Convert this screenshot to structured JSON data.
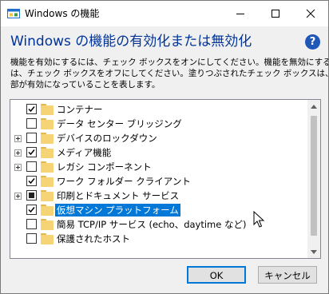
{
  "window": {
    "title": "Windows の機能"
  },
  "heading": "Windows の機能の有効化または無効化",
  "description": {
    "line1": "機能を有効にするには、チェック ボックスをオンにしてください。機能を無効にするに",
    "line2": "は、チェック ボックスをオフにしてください。塗りつぶされたチェック ボックスは、機能の一",
    "line3": "部が有効になっていることを表します。"
  },
  "features": [
    {
      "label": "コンテナー",
      "state": "checked",
      "expandable": false,
      "selected": false
    },
    {
      "label": "データ センター ブリッジング",
      "state": "unchecked",
      "expandable": false,
      "selected": false
    },
    {
      "label": "デバイスのロックダウン",
      "state": "unchecked",
      "expandable": true,
      "selected": false
    },
    {
      "label": "メディア機能",
      "state": "checked",
      "expandable": true,
      "selected": false
    },
    {
      "label": "レガシ コンポーネント",
      "state": "unchecked",
      "expandable": true,
      "selected": false
    },
    {
      "label": "ワーク フォルダー クライアント",
      "state": "checked",
      "expandable": false,
      "selected": false
    },
    {
      "label": "印刷とドキュメント サービス",
      "state": "partial",
      "expandable": true,
      "selected": false
    },
    {
      "label": "仮想マシン プラットフォーム",
      "state": "checked",
      "expandable": false,
      "selected": true
    },
    {
      "label": "簡易 TCP/IP サービス (echo、daytime など)",
      "state": "unchecked",
      "expandable": false,
      "selected": false
    },
    {
      "label": "保護されたホスト",
      "state": "unchecked",
      "expandable": false,
      "selected": false
    }
  ],
  "buttons": {
    "ok": "OK",
    "cancel": "キャンセル"
  },
  "colors": {
    "heading": "#003399",
    "selection": "#0078d7",
    "help": "#1f56b7"
  }
}
